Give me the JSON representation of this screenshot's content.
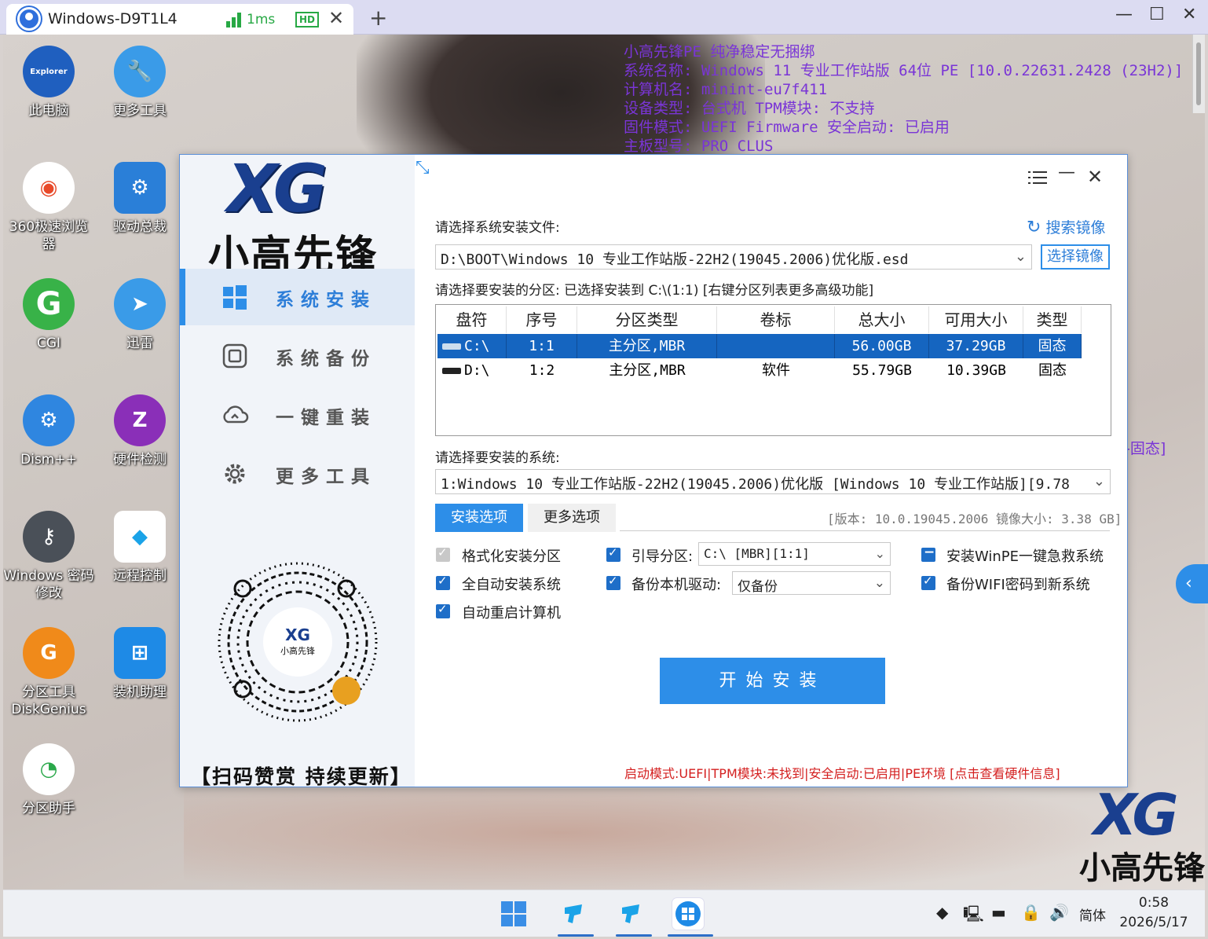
{
  "remote": {
    "tab_title": "Windows-D9T1L4",
    "latency": "1ms",
    "hd": "HD",
    "close": "✕",
    "plus": "+",
    "win_min": "—",
    "win_max": "☐",
    "win_close": "✕"
  },
  "sysinfo": {
    "lines": [
      "小高先锋PE 纯净稳定无捆绑",
      "系统名称: Windows 11 专业工作站版 64位 PE [10.0.22631.2428 (23H2)]",
      "计算机名: minint-eu7f411",
      "设备类型: 台式机 TPM模块: 不支持",
      "固件模式: UEFI Firmware  安全启动: 已启用",
      "主板型号: PRO CLUS"
    ],
    "side": "-固态]"
  },
  "desktop_icons": [
    {
      "label": "此电脑",
      "icon": "explorer-icon",
      "color": "#1f5fbf",
      "glyph": "Explorer"
    },
    {
      "label": "更多工具",
      "icon": "wrench-icon",
      "color": "#3a9be8",
      "glyph": "🔧"
    },
    {
      "label": "360极速浏览器",
      "icon": "browser-360-icon",
      "color": "#ffffff",
      "glyph": "◉"
    },
    {
      "label": "驱动总裁",
      "icon": "driver-icon",
      "color": "#2a7fd8",
      "glyph": "⚙"
    },
    {
      "label": "CGI",
      "icon": "cgi-icon",
      "color": "#38b248",
      "glyph": "G"
    },
    {
      "label": "迅雷",
      "icon": "thunder-icon",
      "color": "#3a9be8",
      "glyph": "➤"
    },
    {
      "label": "Dism++",
      "icon": "dism-icon",
      "color": "#2f86e0",
      "glyph": "⚙"
    },
    {
      "label": "硬件检测",
      "icon": "hardware-check-icon",
      "color": "#8a2fb8",
      "glyph": "Z"
    },
    {
      "label": "Windows 密码修改",
      "icon": "key-icon",
      "color": "#4a5058",
      "glyph": "⚷"
    },
    {
      "label": "远程控制",
      "icon": "remote-control-icon",
      "color": "#ffffff",
      "glyph": "◆"
    },
    {
      "label": "分区工具DiskGenius",
      "icon": "diskgenius-icon",
      "color": "#f08a1a",
      "glyph": "G"
    },
    {
      "label": "装机助理",
      "icon": "install-assistant-icon",
      "color": "#1e8ae6",
      "glyph": "⊞"
    },
    {
      "label": "分区助手",
      "icon": "partition-assistant-icon",
      "color": "#ffffff",
      "glyph": "◔"
    }
  ],
  "app": {
    "logo_xg": "XG",
    "logo_cn": "小高先锋",
    "nav": [
      {
        "label": "系统安装",
        "icon": "windows-icon"
      },
      {
        "label": "系统备份",
        "icon": "backup-icon"
      },
      {
        "label": "一键重装",
        "icon": "cloud-reinstall-icon"
      },
      {
        "label": "更多工具",
        "icon": "gear-icon"
      }
    ],
    "qr_center": "XG 小高先锋",
    "qr_caption": "【扫码赞赏 持续更新】",
    "label_select_file": "请选择系统安装文件:",
    "search_image": "搜索镜像",
    "file_value": "D:\\BOOT\\Windows 10 专业工作站版-22H2(19045.2006)优化版.esd",
    "pick_image": "选择镜像",
    "label_partition": "请选择要安装的分区: 已选择安装到 C:\\(1:1) [右键分区列表更多高级功能]",
    "partition_headers": [
      "盘符",
      "序号",
      "分区类型",
      "卷标",
      "总大小",
      "可用大小",
      "类型"
    ],
    "partitions": [
      {
        "drive": "C:\\",
        "index": "1:1",
        "type": "主分区,MBR",
        "label": "",
        "total": "56.00GB",
        "free": "37.29GB",
        "kind": "固态"
      },
      {
        "drive": "D:\\",
        "index": "1:2",
        "type": "主分区,MBR",
        "label": "软件",
        "total": "55.79GB",
        "free": "10.39GB",
        "kind": "固态"
      }
    ],
    "label_system": "请选择要安装的系统:",
    "system_value": "1:Windows 10 专业工作站版-22H2(19045.2006)优化版 [Windows 10 专业工作站版][9.78",
    "tab_install": "安装选项",
    "tab_more": "更多选项",
    "version_info": "[版本: 10.0.19045.2006 镜像大小: 3.38 GB]",
    "opt_format": "格式化安装分区",
    "opt_auto": "全自动安装系统",
    "opt_reboot": "自动重启计算机",
    "opt_boot": "引导分区:",
    "boot_value": "C:\\ [MBR][1:1]",
    "opt_backup_driver": "备份本机驱动:",
    "backup_value": "仅备份",
    "opt_winpe": "安装WinPE一键急救系统",
    "opt_wifi": "备份WIFI密码到新系统",
    "start": "开始安装",
    "status": "启动模式:UEFI|TPM模块:未找到|安全启动:已启用|PE环境 [点击查看硬件信息]"
  },
  "brand": {
    "xg": "XG",
    "cn": "小高先锋"
  },
  "taskbar": {
    "lang": "简体",
    "time": "0:58",
    "date": "2026/5/17"
  }
}
